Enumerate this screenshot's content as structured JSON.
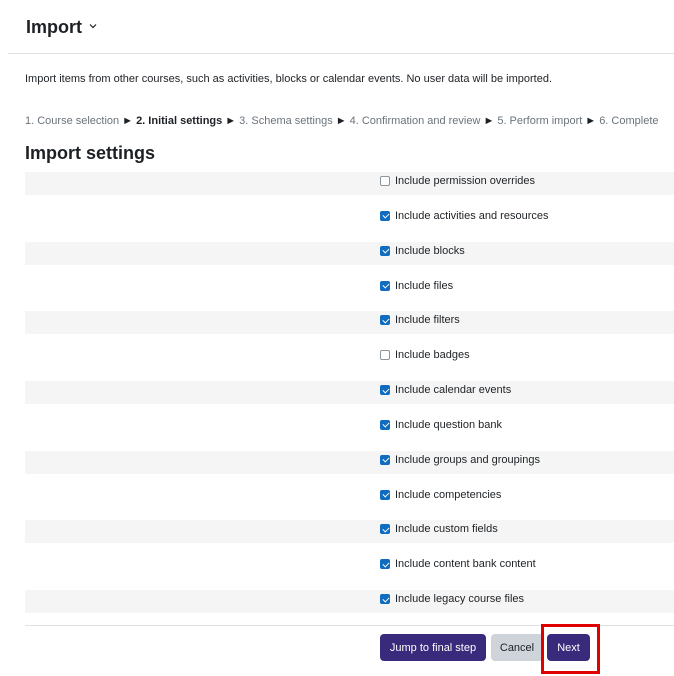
{
  "header": {
    "title": "Import",
    "chevron_icon": "chevron-down-icon"
  },
  "intro": "Import items from other courses, such as activities, blocks or calendar events. No user data will be imported.",
  "steps": [
    {
      "label": "1. Course selection",
      "current": false
    },
    {
      "label": "2. Initial settings",
      "current": true
    },
    {
      "label": "3. Schema settings",
      "current": false
    },
    {
      "label": "4. Confirmation and review",
      "current": false
    },
    {
      "label": "5. Perform import",
      "current": false
    },
    {
      "label": "6. Complete",
      "current": false
    }
  ],
  "step_separator": "►",
  "section_title": "Import settings",
  "settings": [
    {
      "label": "Include permission overrides",
      "checked": false
    },
    {
      "label": "Include activities and resources",
      "checked": true
    },
    {
      "label": "Include blocks",
      "checked": true
    },
    {
      "label": "Include files",
      "checked": true
    },
    {
      "label": "Include filters",
      "checked": true
    },
    {
      "label": "Include badges",
      "checked": false
    },
    {
      "label": "Include calendar events",
      "checked": true
    },
    {
      "label": "Include question bank",
      "checked": true
    },
    {
      "label": "Include groups and groupings",
      "checked": true
    },
    {
      "label": "Include competencies",
      "checked": true
    },
    {
      "label": "Include custom fields",
      "checked": true
    },
    {
      "label": "Include content bank content",
      "checked": true
    },
    {
      "label": "Include legacy course files",
      "checked": true
    }
  ],
  "buttons": {
    "jump": "Jump to final step",
    "cancel": "Cancel",
    "next": "Next"
  },
  "colors": {
    "primary": "#3a2a7c",
    "checkbox": "#0f6cbf",
    "highlight": "#e00000"
  }
}
